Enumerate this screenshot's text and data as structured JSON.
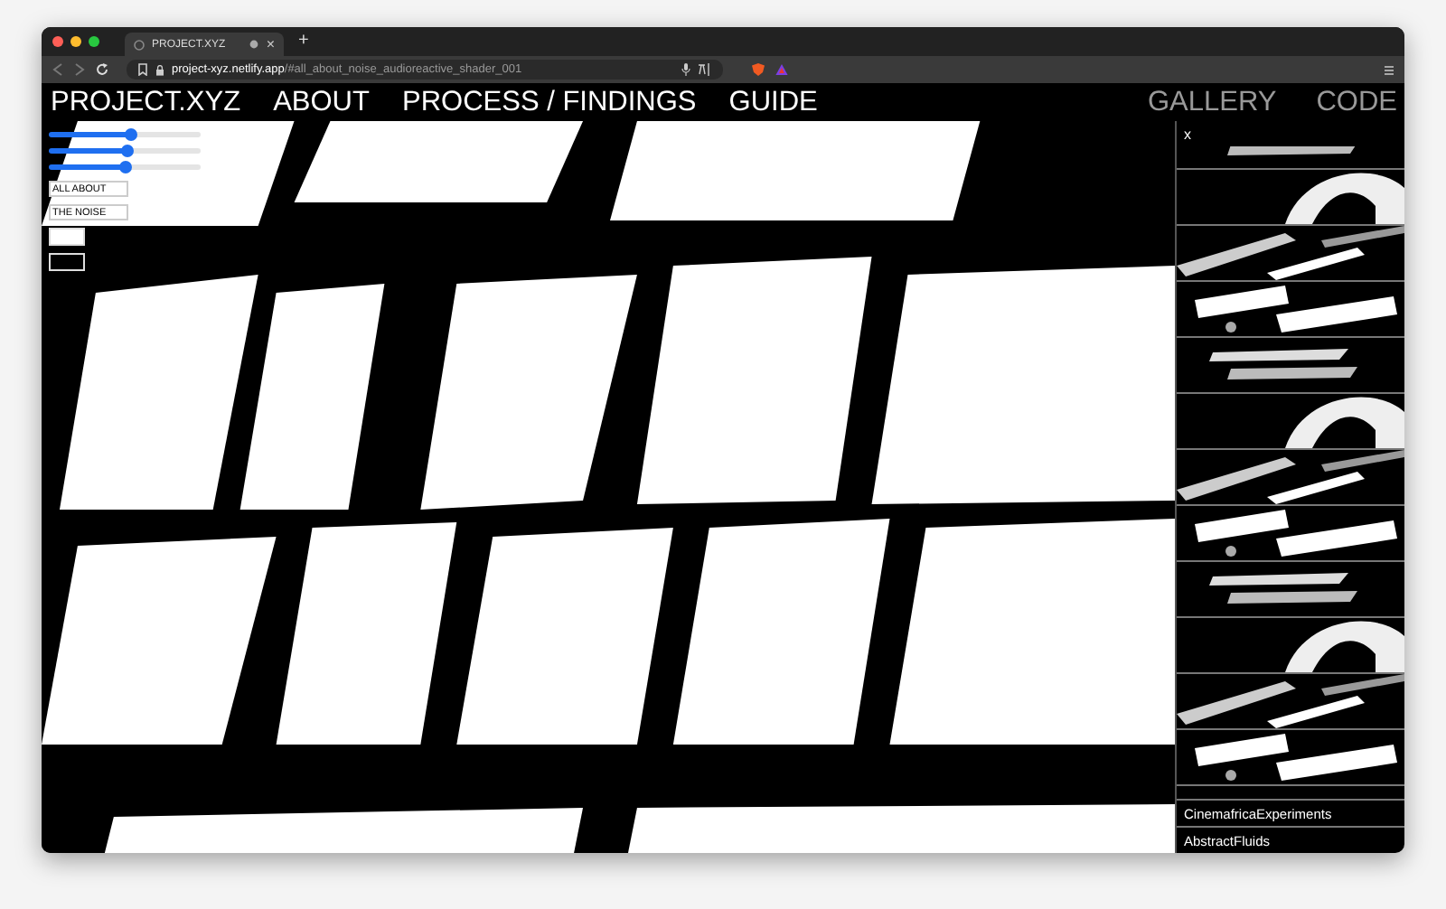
{
  "browser": {
    "tab": {
      "title": "PROJECT.XYZ",
      "close": "×"
    },
    "new_tab": "+",
    "url": {
      "host": "project-xyz.netlify.app",
      "path": "/#all_about_noise_audioreactive_shader_001"
    }
  },
  "nav": {
    "links": [
      "PROJECT.XYZ",
      "ABOUT",
      "PROCESS / FINDINGS",
      "GUIDE"
    ],
    "side_links": [
      "GALLERY",
      "CODE"
    ]
  },
  "controls": {
    "sliders": [
      {
        "level": 0.55
      },
      {
        "level": 0.52
      },
      {
        "level": 0.5
      }
    ],
    "text_fields": [
      {
        "value": "ALL ABOUT"
      },
      {
        "value": "THE NOISE"
      }
    ],
    "swatches": [
      {
        "color": "#ffffff"
      },
      {
        "color": "#000000"
      }
    ]
  },
  "stage": {
    "kind": "picture"
  },
  "gallery": {
    "close": "x",
    "thumbnails": [
      {
        "kind": "picture"
      },
      {
        "kind": "picture"
      },
      {
        "kind": "picture"
      },
      {
        "kind": "picture"
      },
      {
        "kind": "picture"
      },
      {
        "kind": "picture"
      },
      {
        "kind": "picture"
      },
      {
        "kind": "picture"
      },
      {
        "kind": "picture"
      },
      {
        "kind": "picture"
      },
      {
        "kind": "picture"
      },
      {
        "kind": "picture"
      }
    ],
    "projects": [
      "CinemafricaExperiments",
      "AbstractFluids"
    ]
  }
}
